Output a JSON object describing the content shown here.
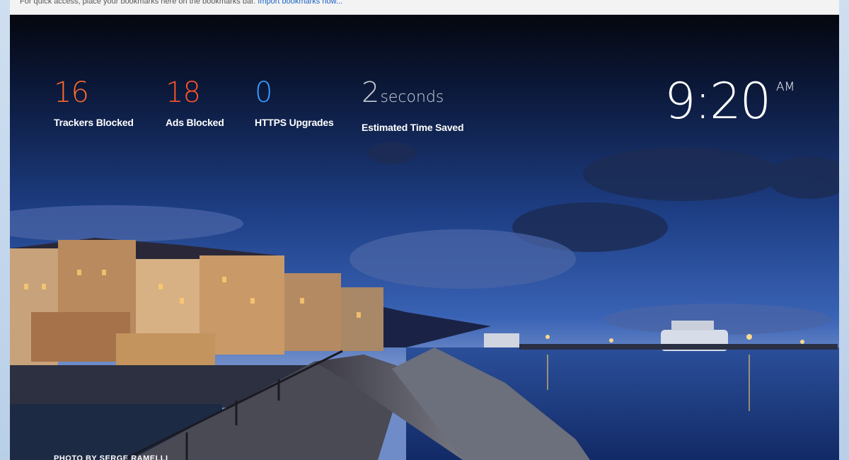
{
  "bookmarks_bar": {
    "message": "For quick access, place your bookmarks here on the bookmarks bar.",
    "import_link": "Import bookmarks now..."
  },
  "stats": {
    "trackers": {
      "value": "16",
      "label": "Trackers Blocked"
    },
    "ads": {
      "value": "18",
      "label": "Ads Blocked"
    },
    "https": {
      "value": "0",
      "label": "HTTPS Upgrades"
    },
    "time_saved": {
      "value": "2",
      "unit": "seconds",
      "label": "Estimated Time Saved"
    }
  },
  "clock": {
    "time": "9:20",
    "ampm": "AM"
  },
  "photo_credit": "PHOTO BY SERGE RAMELLI",
  "colors": {
    "trackers": "#fb6a2c",
    "ads": "#fb542b",
    "https": "#3a9aff",
    "time_saved": "#c8ccd4"
  }
}
